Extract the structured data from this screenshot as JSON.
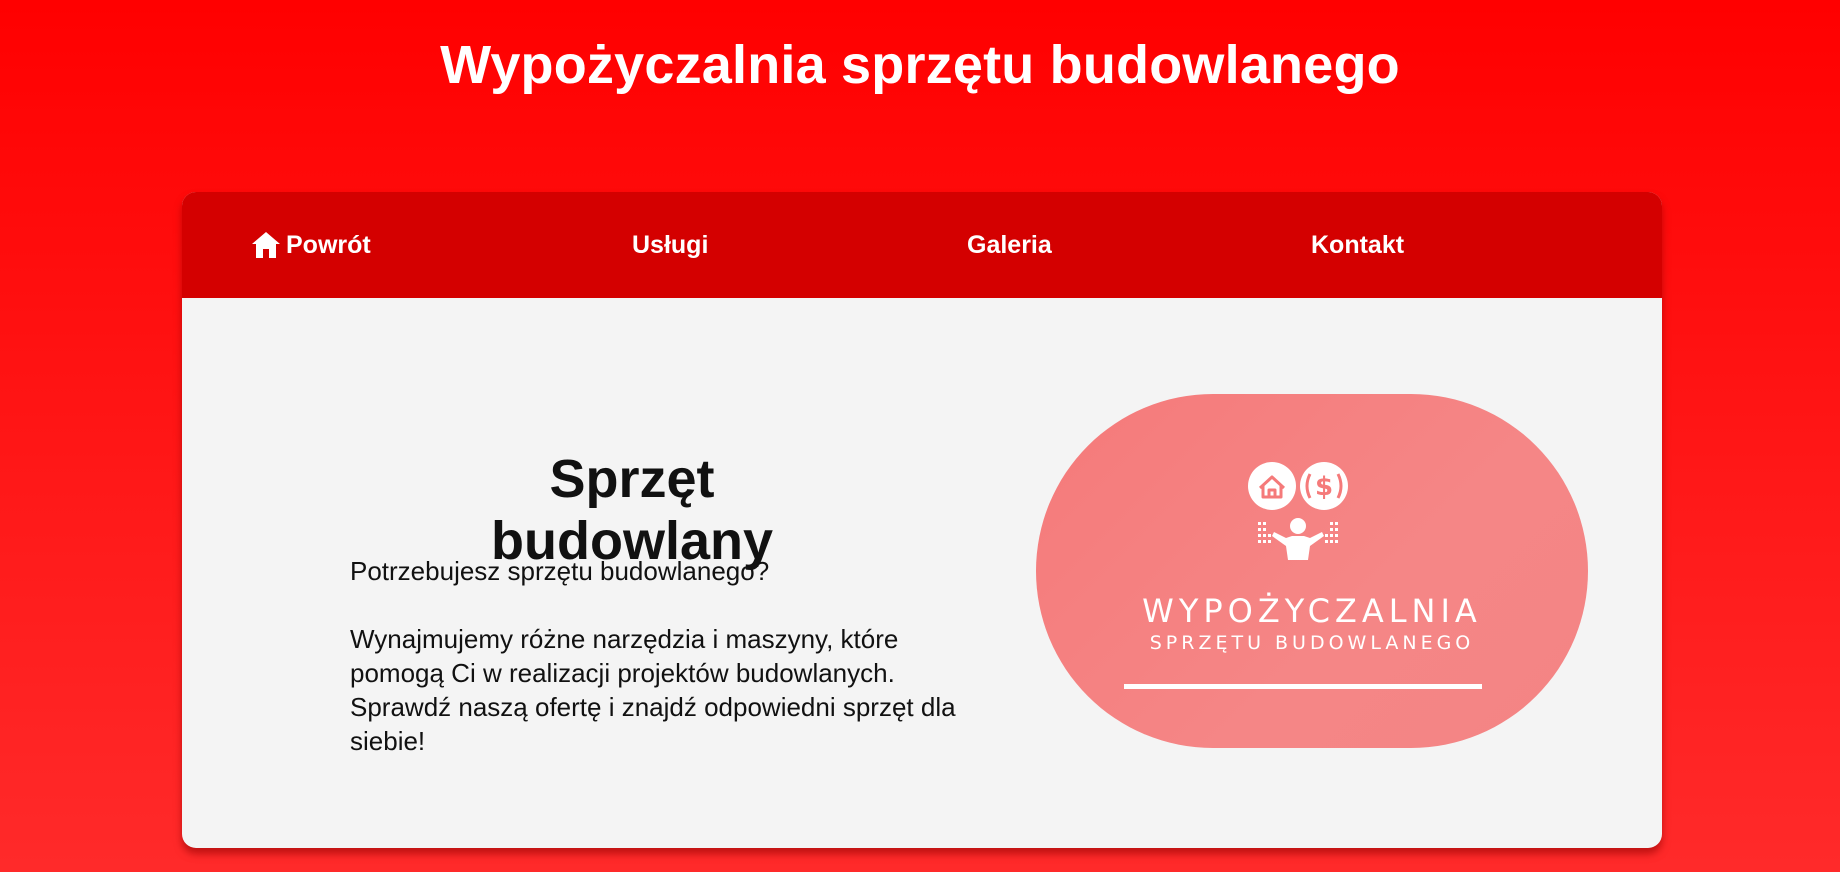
{
  "header": {
    "title": "Wypożyczalnia sprzętu budowlanego"
  },
  "nav": {
    "items": [
      {
        "label": "Powrót",
        "icon": "home-icon"
      },
      {
        "label": "Usługi"
      },
      {
        "label": "Galeria"
      },
      {
        "label": "Kontakt"
      }
    ]
  },
  "hero": {
    "title": "Sprzęt budowlany",
    "paragraph1": "Potrzebujesz sprzętu budowlanego?",
    "paragraph2": "Wynajmujemy różne narzędzia i maszyny, które pomogą Ci w realizacji projektów budowlanych. Sprawdź naszą ofertę i znajdź odpowiedni sprzęt dla siebie!"
  },
  "logo": {
    "line1": "WYPOŻYCZALNIA",
    "line2": "SPRZĘTU BUDOWLANEGO",
    "icons": [
      "house-icon",
      "dollar-icon",
      "person-icon"
    ]
  },
  "colors": {
    "background": "#ff0000",
    "nav": "#d40000",
    "card": "#f4f4f4",
    "logo_pill": "#f57f7f"
  }
}
